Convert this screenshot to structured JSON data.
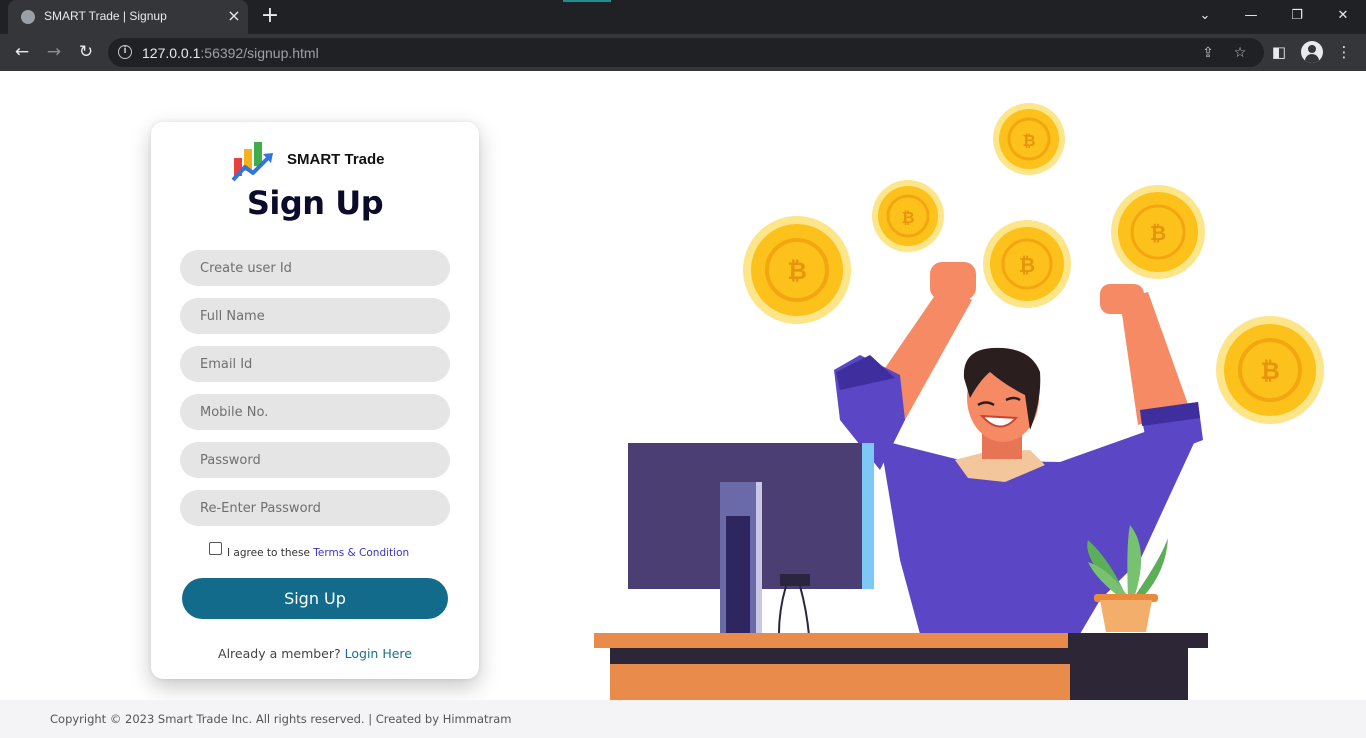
{
  "browser": {
    "tab_title": "SMART Trade | Signup",
    "tab_close_glyph": "×",
    "new_tab_glyph": "+",
    "url_host": "127.0.0.1",
    "url_rest": ":56392/signup.html",
    "window_controls": {
      "tab_search": "⌄",
      "minimize": "—",
      "restore": "❐",
      "close": "✕"
    },
    "nav": {
      "back": "←",
      "forward": "→",
      "reload": "↻"
    },
    "icons": {
      "info": "i",
      "share": "⇪",
      "bookmark": "☆",
      "side_panel": "◧",
      "menu": "⋮"
    }
  },
  "card": {
    "brand": "SMART Trade",
    "heading": "Sign Up",
    "fields": {
      "user_id": "Create user Id",
      "full_name": "Full Name",
      "email": "Email Id",
      "mobile": "Mobile No.",
      "password": "Password",
      "re_password": "Re-Enter Password"
    },
    "agree_text": "I agree to these ",
    "agree_link": "Terms & Condition",
    "submit_label": "Sign Up",
    "member_text": "Already a member? ",
    "member_link": "Login Here"
  },
  "footer": {
    "text": "Copyright © 2023 Smart Trade Inc. All rights reserved. | Created by Himmatram"
  },
  "colors": {
    "primary": "#136b8c",
    "link": "#3a34c9",
    "coin": "#fcc21b",
    "shirt": "#5b46c6"
  }
}
